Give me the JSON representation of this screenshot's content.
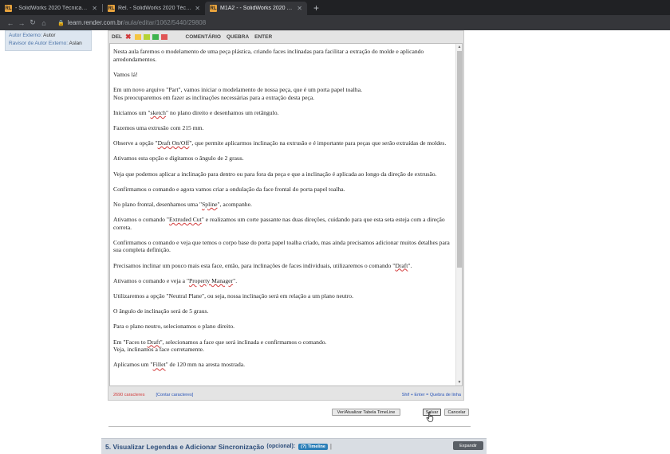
{
  "browser": {
    "tabs": [
      {
        "icon": "RL",
        "title": "- SolidWorks 2020 Técnicas para Mol...",
        "active": false
      },
      {
        "icon": "RL",
        "title": "Rel. - SolidWorks 2020 Técnicas par...",
        "active": false
      },
      {
        "icon": "RL",
        "title": "M1A2 - - SolidWorks 2020 Técnicas...",
        "active": true
      }
    ],
    "new_tab": "+",
    "url_host": "learn.render.com.br",
    "url_path": "/aula/editar/1062/5440/29808"
  },
  "info": {
    "autor_label": "Autor Externo:",
    "autor_value": "Autor",
    "revisor_label": "Ravisor de Autor Externo:",
    "revisor_value": "Aslan"
  },
  "toolbar": {
    "del": "DEL",
    "colors": [
      "#f5c542",
      "#b5d335",
      "#3fb34f",
      "#e05656"
    ],
    "comentario": "COMENTÁRIO",
    "quebra": "QUEBRA",
    "enter": "ENTER"
  },
  "content": {
    "p1": "Nesta aula faremos o modelamento de uma peça plástica, criando faces inclinadas para facilitar a extração do molde e aplicando arredondamentos.",
    "p2": "Vamos lá!",
    "p3a": "Em um novo arquivo \"Part\", vamos iniciar o modelamento de nossa peça, que é um porta papel toalha.",
    "p3b": "Nos preocuparemos em fazer as inclinações necessárias para a extração desta peça.",
    "p4a": "Iniciamos um \"",
    "p4w": "sketch",
    "p4b": "\" no plano direito e desenhamos um retângulo.",
    "p5": "Fazemos uma extrusão com 215 mm.",
    "p6a": "Observe a opção \"",
    "p6w": "Draft On/Off",
    "p6b": "\", que permite aplicarmos inclinação na extrusão e é importante para peças que serão extraídas de moldes.",
    "p7": "Ativamos esta opção e digitamos o ângulo de 2 graus.",
    "p8": "Veja que podemos aplicar a inclinação para dentro ou para fora da peça e que a inclinação é aplicada ao longo da direção de extrusão.",
    "p9": "Confirmamos o comando e agora vamos criar a ondulação da face frontal do porta papel toalha.",
    "p10a": "No plano frontal, desenhamos uma \"",
    "p10w": "Spline",
    "p10b": "\", acompanhe.",
    "p11a": "Ativamos o comando \"",
    "p11w": "Extruded Cut",
    "p11b": "\" e realizamos um corte passante nas duas direções, cuidando para que esta seta esteja com a direção correta.",
    "p12": "Confirmamos o comando e veja que temos o corpo base do porta papel toalha criado, mas ainda precisamos adicionar muitos detalhes para sua completa definição.",
    "p13a": "Precisamos inclinar um pouco mais esta face, então, para inclinações de faces individuais, utilizaremos o comando \"",
    "p13w": "Draft",
    "p13b": "\".",
    "p14a": "Ativamos o comando e veja a \"",
    "p14w": "Property Manager",
    "p14b": "\".",
    "p15": "Utilizaremos a opção \"Neutral Plane\", ou seja, nossa inclinação será em relação a um plano neutro.",
    "p16": "O ângulo de inclinação será de 5 graus.",
    "p17": "Para o plano neutro, selecionamos o plano direito.",
    "p18a": "Em \"Faces to ",
    "p18w": "Draft",
    "p18b": "\", selecionamos a face que será inclinada e confirmamos o comando.",
    "p18c": "Veja, inclinamos a face corretamente.",
    "p19a": "Aplicamos um \"",
    "p19w": "Fillet",
    "p19b": "\" de 120 mm na aresta mostrada."
  },
  "footer": {
    "char_count": "2690 caracteres",
    "count_link": "[Contar caracteres]",
    "hint": "Shif + Enter = Quebra de linha"
  },
  "buttons": {
    "timeline": "Ver/Atualizar Tabela TimeLine",
    "salvar": "Salvar",
    "cancelar": "Cancelar"
  },
  "section": {
    "title": "5. Visualizar Legendas e Adicionar Sincronização",
    "optional": "(opcional):",
    "badge": "(?) Timeline",
    "sep": "|",
    "expand": "Expandir"
  }
}
